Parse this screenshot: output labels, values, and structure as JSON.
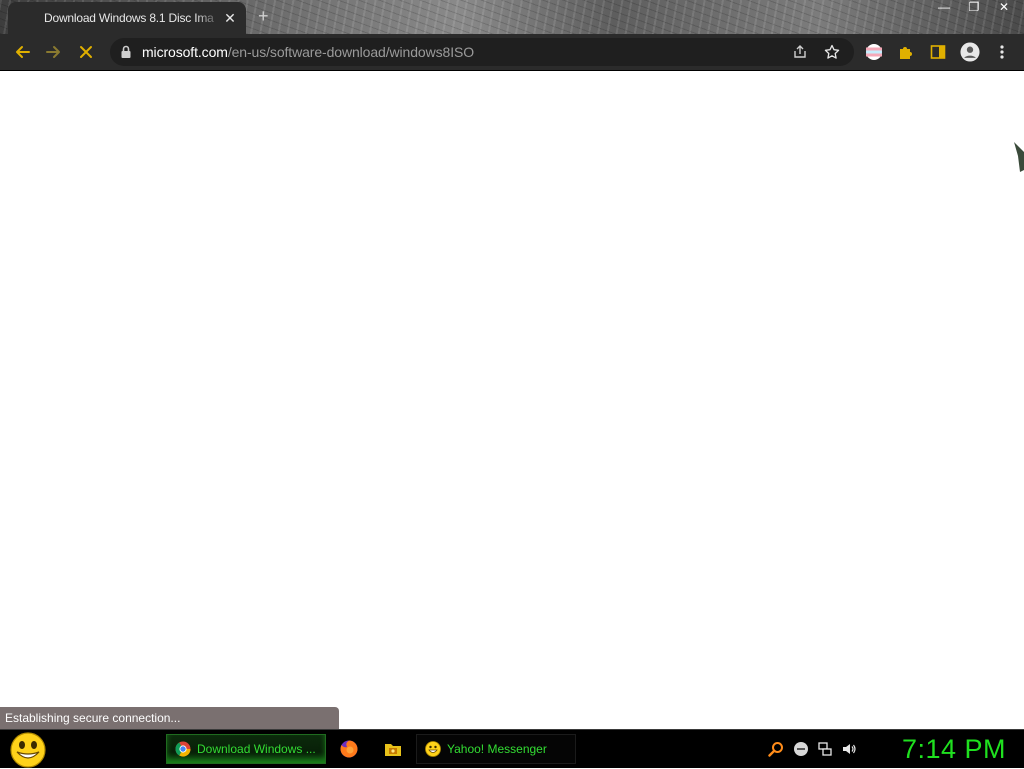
{
  "browser": {
    "tab": {
      "title": "Download Windows 8.1 Disc Ima",
      "close": "✕"
    },
    "new_tab": "+",
    "window_controls": {
      "minimize": "—",
      "maximize": "❐",
      "close": "✕"
    },
    "address": {
      "host": "microsoft.com",
      "path": "/en-us/software-download/windows8ISO"
    },
    "status": "Establishing secure connection..."
  },
  "taskbar": {
    "tasks": [
      {
        "label": "Download Windows ...",
        "icon": "chrome-icon",
        "active": true
      },
      {
        "label": "Yahoo! Messenger",
        "icon": "yahoo-smiley-icon",
        "active": false
      }
    ],
    "quick_launch": [
      "firefox-icon",
      "folder-icon"
    ],
    "tray": [
      "search-icon",
      "messenger-icon",
      "network-icon",
      "volume-icon"
    ],
    "clock": "7:14 PM"
  },
  "colors": {
    "taskbar_text": "#33dd33",
    "clock": "#1fe01f",
    "toolbar_bg": "#2b2b2b",
    "extension_accent": "#e0b000"
  }
}
